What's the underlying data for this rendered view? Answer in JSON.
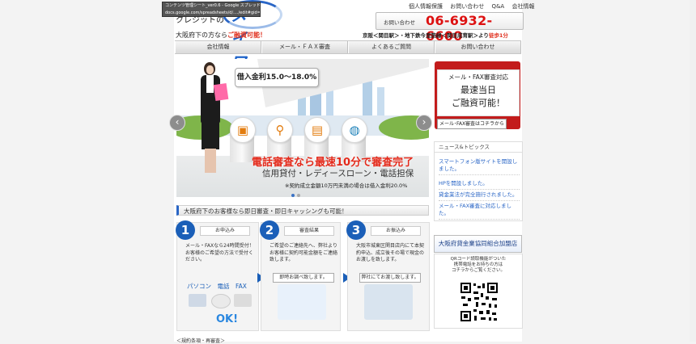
{
  "tooltip": {
    "line1": "コンテンツ管理シート_ver0.6 - Google スプレッド",
    "line2": "docs.google.com/spreadsheets/d/..../edit#gid=..."
  },
  "header": {
    "logo_word": "クレジットの",
    "logo_name": "メイワ",
    "tagline_prefix": "大阪府下の方なら",
    "tagline_emph": "ご融資可能！",
    "toplinks": [
      "個人情報保護",
      "お問い合わせ",
      "Q&A",
      "会社情報"
    ],
    "phone_label": "お問い合わせ",
    "phone": "06-6932-6600",
    "access_text": "京阪＜関目駅＞・地下鉄今里筋線＜関目成育駅＞より",
    "access_emph": "徒歩1分"
  },
  "nav": [
    "会社情報",
    "メール・ＦＡＸ審査",
    "よくあるご質問",
    "お問い合わせ"
  ],
  "banner": {
    "speech": "借入金利15.0～18.0%",
    "headline": "電話審査なら最速10分で審査完了",
    "subline": "信用貸付・レディースローン・電話担保",
    "note": "※契約成立金額10万円未満の場合は借入金利20.0%"
  },
  "side": {
    "l1": "メール・FAX審査対応",
    "l2": "最速当日",
    "l3": "ご融資可能！",
    "footer": "メール･FAX審査はコチラから"
  },
  "news": {
    "heading": "ニュース&トピックス",
    "items": [
      "スマートフォン版サイトを開設しました。",
      "HPを開設しました。",
      "貸金業法が完全施行されました。",
      "メール・FAX審査に対応しました。"
    ]
  },
  "kyokai": "大阪府貸金業協同組合加盟店",
  "qr_text": [
    "QRコード読取機能がついた",
    "携帯電話をお持ちの方は",
    "コチラからご覧ください。"
  ],
  "section_title": "大阪府下のお客様なら即日審査・即日キャッシングも可能！",
  "steps": [
    {
      "num": "1",
      "title": "お申込み",
      "body": "メール・FAXなら24時間受付！お客様のご希望の方法で受付ください。",
      "devices": "パソコン　電話　FAX",
      "ok": "OK!"
    },
    {
      "num": "2",
      "title": "審査結果",
      "body": "ご希望のご連絡先へ、弊社よりお客様に契約可能金額をご連絡致します。",
      "btn": "即時お調べ致します。"
    },
    {
      "num": "3",
      "title": "お振込み",
      "body": "大阪市城東区関目店内にて本契約申込、成立後その場で現金のお渡しを致します。",
      "btn": "弊社にてお渡し致します。"
    }
  ],
  "footer_link": "＜規約条項・再審査＞"
}
